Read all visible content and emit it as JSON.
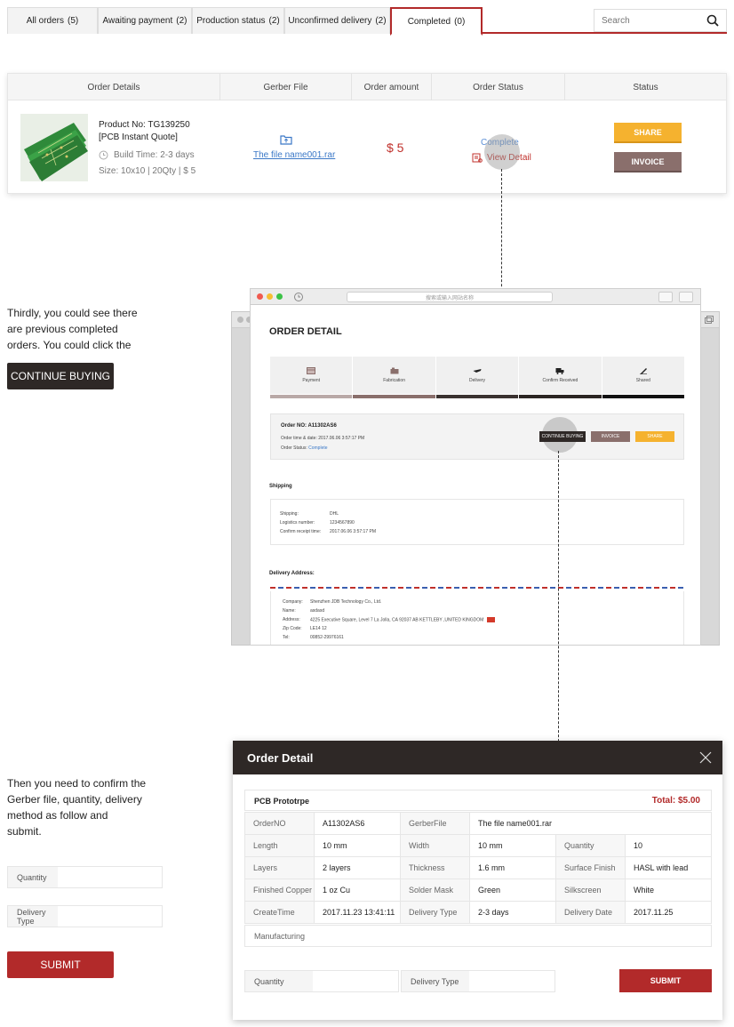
{
  "tabs": [
    {
      "label": "All orders",
      "count": "(5)"
    },
    {
      "label": "Awaiting payment",
      "count": "(2)"
    },
    {
      "label": "Production status",
      "count": "(2)"
    },
    {
      "label": "Unconfirmed delivery",
      "count": "(2)"
    },
    {
      "label": "Completed",
      "count": "(0)",
      "active": true
    }
  ],
  "search": {
    "placeholder": "Search"
  },
  "order_table": {
    "headers": [
      "Order Details",
      "Gerber File",
      "Order amount",
      "Order Status",
      "Status"
    ],
    "row": {
      "product_no": "Product No: TG139250",
      "product_type": "[PCB Instant Quote]",
      "build_time": "Build Time: 2-3 days",
      "size": "Size: 10x10 | 20Qty | $ 5",
      "gerber_file": "The file name001.rar",
      "amount": "$ 5",
      "status": "Complete",
      "view_detail": "View Detail",
      "share_label": "SHARE",
      "invoice_label": "INVOICE"
    }
  },
  "instructions": {
    "step3_lines": [
      "Thirdly, you could see there",
      "are previous completed",
      "orders. You could click the"
    ],
    "continue_label": "CONTINUE BUYING",
    "step4_lines": [
      "Then you need to confirm the",
      "Gerber file, quantity, delivery",
      "method as follow and",
      "submit."
    ],
    "quantity_label": "Quantity",
    "delivery_label": "Delivery Type",
    "submit_label": "SUBMIT"
  },
  "browser": {
    "url_placeholder": "搜索或输入网站名称",
    "title": "ORDER DETAIL",
    "steps": [
      {
        "label": "Payment",
        "bar": "#b9a9a7"
      },
      {
        "label": "Fabrication",
        "bar": "#8a6f6c"
      },
      {
        "label": "Delivery",
        "bar": "#3a3230"
      },
      {
        "label": "Confirm Received",
        "bar": "#2b2523"
      },
      {
        "label": "Shared",
        "bar": "#111111"
      }
    ],
    "order_no": "Order NO: A11302AS6",
    "order_time": "Order time & date: 2017.06.06   3:57:17 PM",
    "order_status_label": "Order Status: ",
    "order_status_value": "Complete",
    "continue_mini": "CONTINUE BUYING",
    "invoice_mini": "INVOICE",
    "share_mini": "SHARE",
    "shipping_title": "Shipping",
    "shipping": {
      "shipping_k": "Shipping:",
      "shipping_v": "DHL",
      "logistics_k": "Logistics number:",
      "logistics_v": "1234567890",
      "confirm_k": "Confirm receipt time:",
      "confirm_v": "2017.06.06   3:57:17 PM"
    },
    "delivery_title": "Delivery Address:",
    "address": {
      "company_k": "Company:",
      "company_v": "Shenzhen JDB Technology Co., Ltd.",
      "name_k": "Name:",
      "name_v": "asdasd",
      "address_k": "Address:",
      "address_v": "4225 Executive Square, Level 7 La Jolla, CA 92037    AB KETTLEBY ,UNITED KINGDOM",
      "zip_k": "Zip Code:",
      "zip_v": "LE14 12",
      "tel_k": "Tel:",
      "tel_v": "00852-29976161"
    }
  },
  "modal": {
    "title": "Order Detail",
    "section": "PCB Prototrpe",
    "total": "Total:  $5.00",
    "rows": [
      [
        [
          "OrderNO",
          "A11302AS6"
        ],
        [
          "GerberFile",
          "The file name001.rar"
        ]
      ],
      [
        [
          "Length",
          "10 mm"
        ],
        [
          "Width",
          "10 mm"
        ],
        [
          "Quantity",
          "10"
        ]
      ],
      [
        [
          "Layers",
          "2 layers"
        ],
        [
          "Thickness",
          "1.6 mm"
        ],
        [
          "Surface Finish",
          "HASL with lead"
        ]
      ],
      [
        [
          "Finished Copper",
          "1 oz Cu"
        ],
        [
          "Solder Mask",
          "Green"
        ],
        [
          "Silkscreen",
          "White"
        ]
      ],
      [
        [
          "CreateTime",
          "2017.11.23  13:41:11"
        ],
        [
          "Delivery Type",
          "2-3 days"
        ],
        [
          "Delivery Date",
          "2017.11.25"
        ]
      ]
    ],
    "manufacturing": "Manufacturing",
    "quantity_label": "Quantity",
    "delivery_label": "Delivery Type",
    "submit_label": "SUBMIT"
  }
}
